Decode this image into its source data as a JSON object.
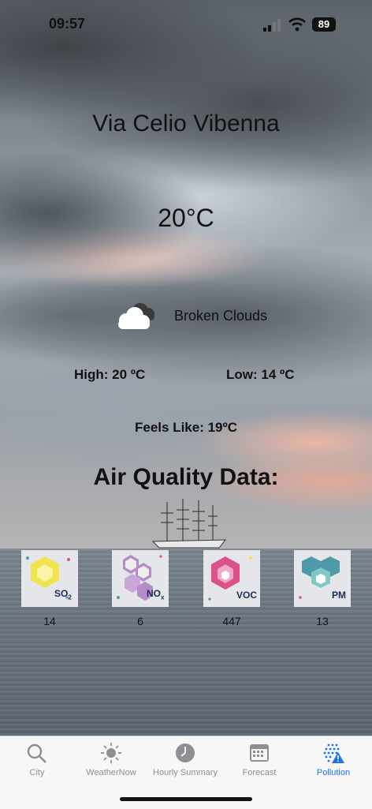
{
  "status_bar": {
    "time": "09:57",
    "battery": "89"
  },
  "weather": {
    "city": "Via Celio Vibenna",
    "temperature": "20°C",
    "condition": "Broken Clouds",
    "condition_icon": "cloud-icon",
    "high": "High: 20 ºC",
    "low": "Low: 14 ºC",
    "feels_like": "Feels Like: 19ºC"
  },
  "air_quality": {
    "title": "Air Quality Data:",
    "items": [
      {
        "label": "SO",
        "sub": "2",
        "value": "14",
        "color": "#f2e23a"
      },
      {
        "label": "NO",
        "sub": "x",
        "value": "6",
        "color": "#b58cc7"
      },
      {
        "label": "VOC",
        "sub": "",
        "value": "447",
        "color": "#d9528a"
      },
      {
        "label": "PM",
        "sub": "",
        "value": "13",
        "color": "#4e9aa8"
      }
    ]
  },
  "tabs": [
    {
      "label": "City",
      "icon": "search-icon",
      "active": false
    },
    {
      "label": "WeatherNow",
      "icon": "sun-icon",
      "active": false
    },
    {
      "label": "Hourly Summary",
      "icon": "clock-icon",
      "active": false
    },
    {
      "label": "Forecast",
      "icon": "calendar-icon",
      "active": false
    },
    {
      "label": "Pollution",
      "icon": "pollution-warning-icon",
      "active": true
    }
  ],
  "colors": {
    "accent": "#1a73e8",
    "inactive": "#8e8e93"
  }
}
